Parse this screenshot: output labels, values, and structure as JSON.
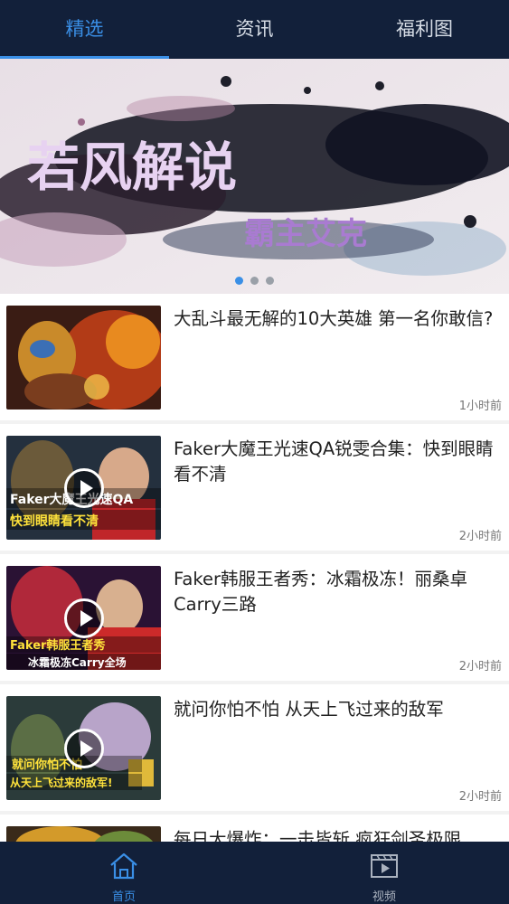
{
  "top_tabs": [
    {
      "label": "精选",
      "active": true
    },
    {
      "label": "资讯",
      "active": false
    },
    {
      "label": "福利图",
      "active": false
    }
  ],
  "banner": {
    "title": "若风解说",
    "subtitle": "霸主艾克",
    "page_count": 3,
    "current_page": 1
  },
  "news": [
    {
      "title": "大乱斗最无解的10大英雄 第一名你敢信?",
      "time": "1小时前",
      "video": false
    },
    {
      "title": "Faker大魔王光速QA锐雯合集：快到眼睛看不清",
      "time": "2小时前",
      "video": true,
      "thumb_text": [
        "Faker大魔王光速QA",
        "快到眼睛看不清"
      ]
    },
    {
      "title": "Faker韩服王者秀：冰霜极冻！丽桑卓Carry三路",
      "time": "2小时前",
      "video": true,
      "thumb_text": [
        "Faker韩服王者秀",
        "冰霜极冻Carry全场"
      ]
    },
    {
      "title": "就问你怕不怕 从天上飞过来的敌军",
      "time": "2小时前",
      "video": true,
      "thumb_text": [
        "就问你怕不怕",
        "从天上飞过来的敌军!"
      ]
    },
    {
      "title": "每日大爆炸：一击皆斩 疯狂剑圣极限",
      "time": "",
      "video": false
    }
  ],
  "bottom_nav": [
    {
      "label": "首页",
      "icon": "home-icon",
      "active": true
    },
    {
      "label": "视频",
      "icon": "video-icon",
      "active": false
    }
  ],
  "colors": {
    "bar_bg": "#12203a",
    "accent": "#3a8fe6"
  }
}
